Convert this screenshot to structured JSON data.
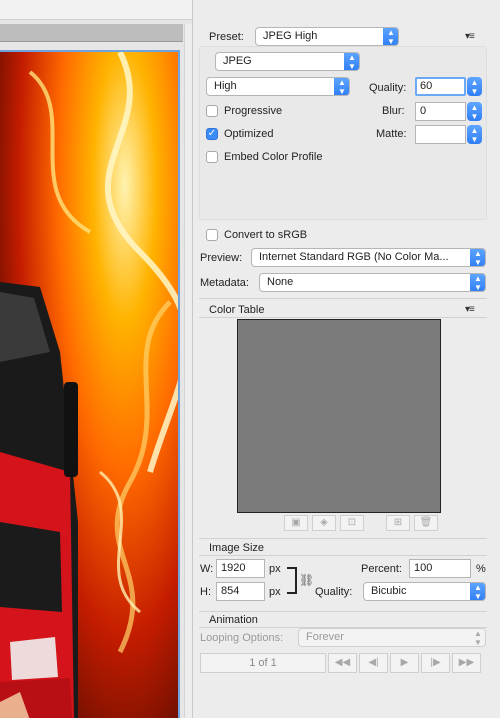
{
  "preview": {
    "description_icon": "image-preview"
  },
  "settings": {
    "preset_label": "Preset:",
    "preset_value": "JPEG High",
    "format_value": "JPEG",
    "quality_level_value": "High",
    "quality_label": "Quality:",
    "quality_value": "60",
    "progressive_label": "Progressive",
    "progressive_checked": false,
    "blur_label": "Blur:",
    "blur_value": "0",
    "optimized_label": "Optimized",
    "optimized_checked": true,
    "matte_label": "Matte:",
    "matte_value": "",
    "embed_profile_label": "Embed Color Profile",
    "embed_profile_checked": false,
    "convert_srgb_label": "Convert to sRGB",
    "convert_srgb_checked": false,
    "preview_label": "Preview:",
    "preview_value": "Internet Standard RGB (No Color Ma...",
    "metadata_label": "Metadata:",
    "metadata_value": "None"
  },
  "color_table": {
    "title": "Color Table",
    "swatch_color": "#7b7b7b"
  },
  "image_size": {
    "title": "Image Size",
    "w_label": "W:",
    "w_value": "1920",
    "h_label": "H:",
    "h_value": "854",
    "unit": "px",
    "percent_label": "Percent:",
    "percent_value": "100",
    "percent_unit": "%",
    "quality_label": "Quality:",
    "quality_value": "Bicubic"
  },
  "animation": {
    "title": "Animation",
    "looping_label": "Looping Options:",
    "looping_value": "Forever",
    "frame_counter": "1 of 1"
  },
  "colors": {
    "accent": "#3b8cf6",
    "panel_bg": "#ececec"
  }
}
